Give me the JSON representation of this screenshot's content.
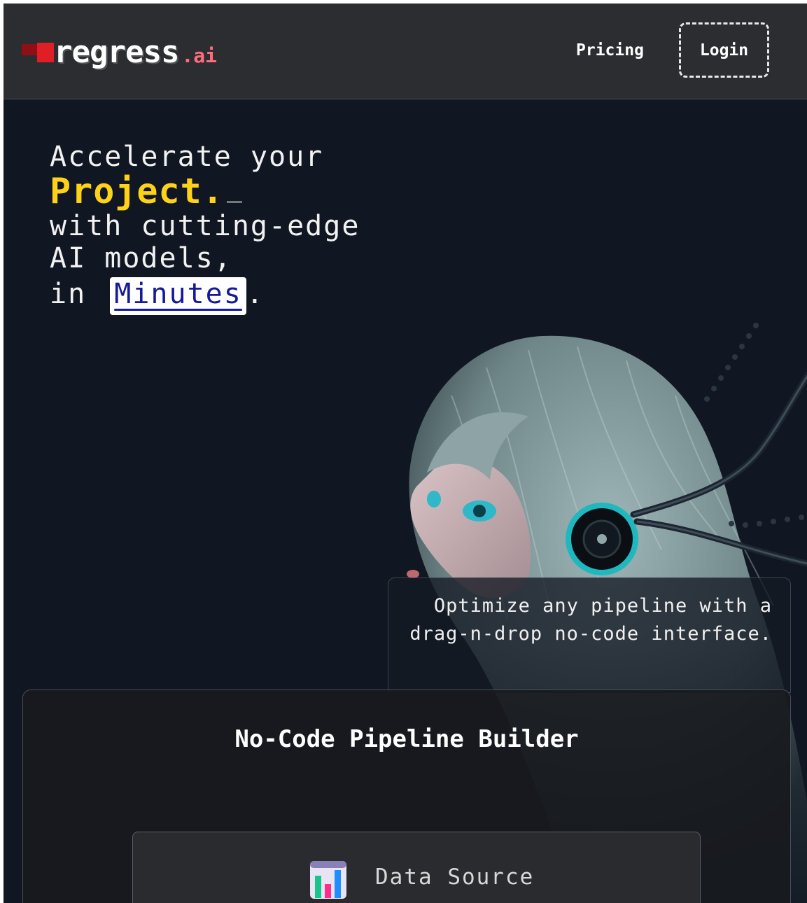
{
  "nav": {
    "logo_text": "regress",
    "logo_suffix": ".ai",
    "pricing_label": "Pricing",
    "login_label": "Login"
  },
  "hero": {
    "line1": "Accelerate your",
    "highlight": "Project.",
    "line3": "with cutting-edge",
    "line4": "AI models,",
    "line5_prefix": "in",
    "minutes": "Minutes",
    "line5_suffix": "."
  },
  "feature": {
    "text": "Optimize any pipeline with a drag-n-drop no-code interface."
  },
  "builder": {
    "title": "No-Code Pipeline Builder",
    "node_label": "Data Source",
    "node_icon": "bar-chart-icon"
  },
  "colors": {
    "accent_yellow": "#ffd21a",
    "logo_red": "#e01e26",
    "background": "#111722"
  }
}
